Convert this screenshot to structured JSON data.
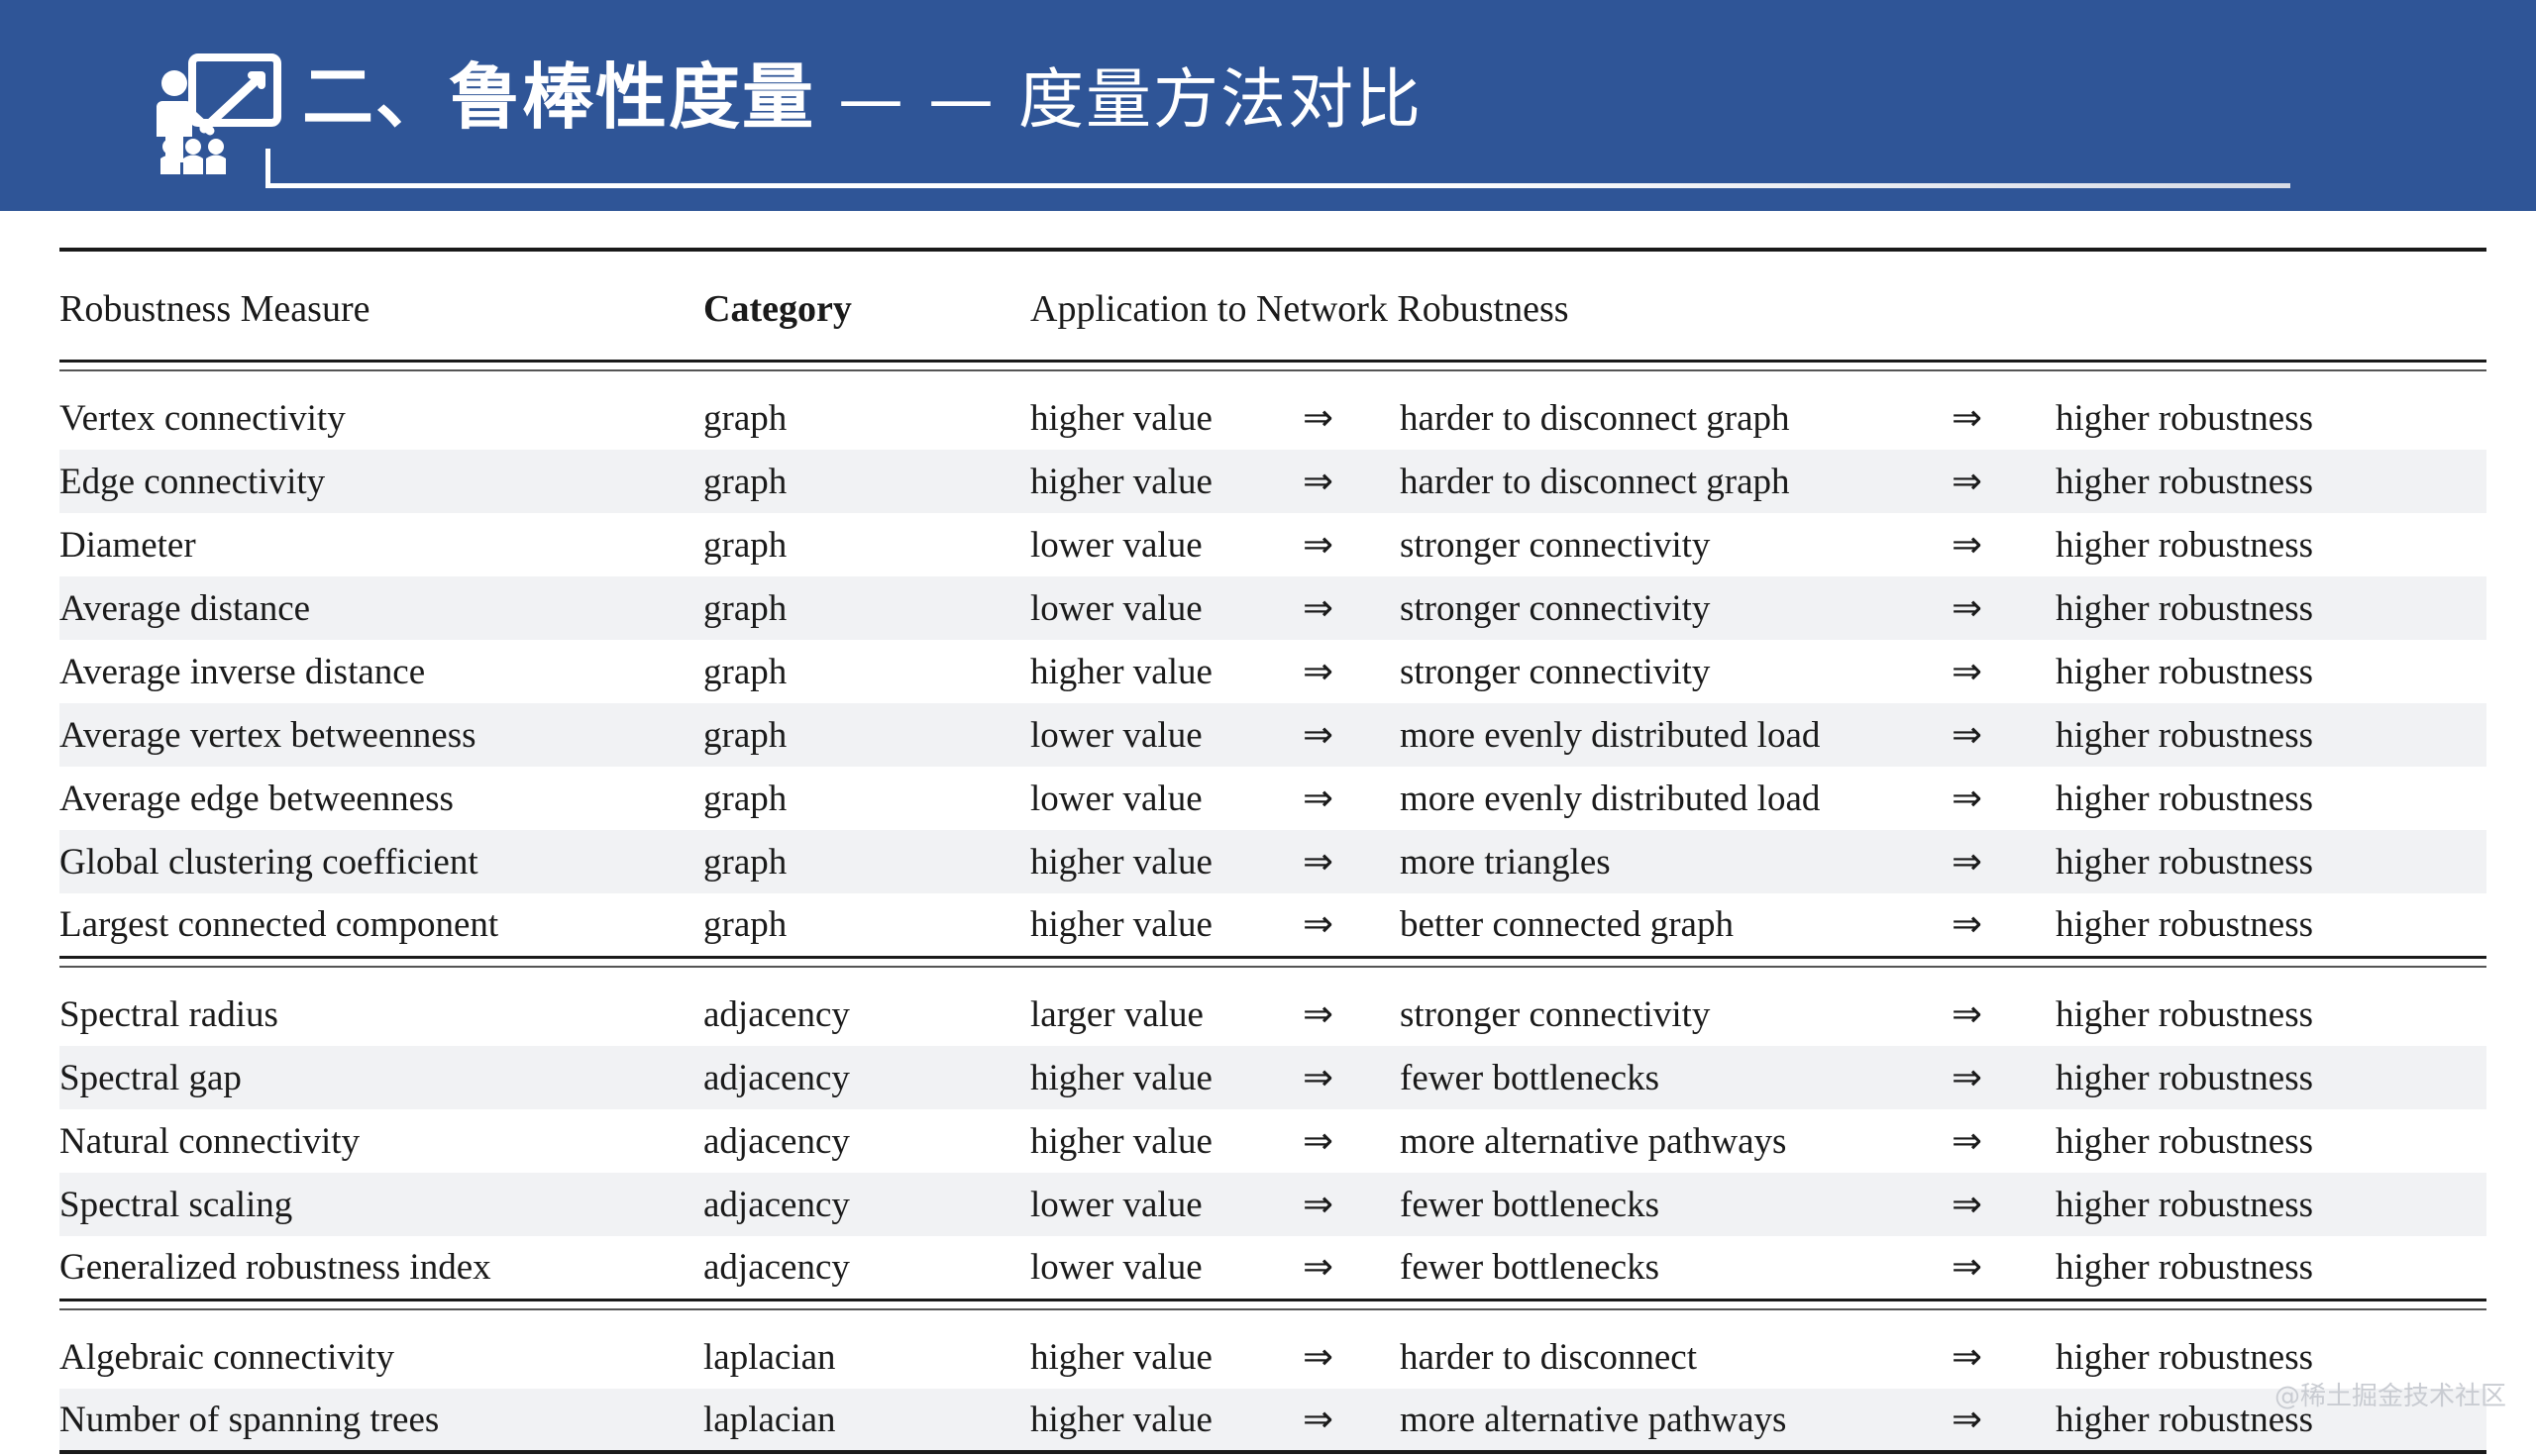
{
  "banner": {
    "background_color": "#2f5597",
    "icon_name": "presenter-whiteboard-icon",
    "title_main": "二、鲁棒性度量",
    "title_sub": " — — 度量方法对比"
  },
  "table": {
    "headers": {
      "measure": "Robustness Measure",
      "category": "Category",
      "application": "Application to Network Robustness"
    },
    "arrow_glyph": "⇒",
    "groups": [
      {
        "name": "graph",
        "rows": [
          {
            "measure": "Vertex connectivity",
            "category": "graph",
            "value": "higher value",
            "a1": "⇒",
            "effect": "harder to disconnect graph",
            "a2": "⇒",
            "result": "higher robustness"
          },
          {
            "measure": "Edge connectivity",
            "category": "graph",
            "value": "higher value",
            "a1": "⇒",
            "effect": "harder to disconnect graph",
            "a2": "⇒",
            "result": "higher robustness"
          },
          {
            "measure": "Diameter",
            "category": "graph",
            "value": "lower value",
            "a1": "⇒",
            "effect": "stronger connectivity",
            "a2": "⇒",
            "result": "higher robustness"
          },
          {
            "measure": "Average distance",
            "category": "graph",
            "value": "lower value",
            "a1": "⇒",
            "effect": "stronger connectivity",
            "a2": "⇒",
            "result": "higher robustness"
          },
          {
            "measure": "Average inverse distance",
            "category": "graph",
            "value": "higher value",
            "a1": "⇒",
            "effect": "stronger connectivity",
            "a2": "⇒",
            "result": "higher robustness"
          },
          {
            "measure": "Average vertex betweenness",
            "category": "graph",
            "value": "lower value",
            "a1": "⇒",
            "effect": "more evenly distributed load",
            "a2": "⇒",
            "result": "higher robustness"
          },
          {
            "measure": "Average edge betweenness",
            "category": "graph",
            "value": "lower value",
            "a1": "⇒",
            "effect": "more evenly distributed load",
            "a2": "⇒",
            "result": "higher robustness"
          },
          {
            "measure": "Global clustering coefficient",
            "category": "graph",
            "value": "higher value",
            "a1": "⇒",
            "effect": "more triangles",
            "a2": "⇒",
            "result": "higher robustness"
          },
          {
            "measure": "Largest connected component",
            "category": "graph",
            "value": "higher value",
            "a1": "⇒",
            "effect": "better connected graph",
            "a2": "⇒",
            "result": "higher robustness"
          }
        ]
      },
      {
        "name": "adjacency",
        "rows": [
          {
            "measure": "Spectral radius",
            "category": "adjacency",
            "value": "larger value",
            "a1": "⇒",
            "effect": "stronger connectivity",
            "a2": "⇒",
            "result": "higher robustness"
          },
          {
            "measure": "Spectral gap",
            "category": "adjacency",
            "value": "higher value",
            "a1": "⇒",
            "effect": "fewer bottlenecks",
            "a2": "⇒",
            "result": "higher robustness"
          },
          {
            "measure": "Natural connectivity",
            "category": "adjacency",
            "value": "higher value",
            "a1": "⇒",
            "effect": "more alternative pathways",
            "a2": "⇒",
            "result": "higher robustness"
          },
          {
            "measure": "Spectral scaling",
            "category": "adjacency",
            "value": "lower value",
            "a1": "⇒",
            "effect": "fewer bottlenecks",
            "a2": "⇒",
            "result": "higher robustness"
          },
          {
            "measure": "Generalized robustness index",
            "category": "adjacency",
            "value": "lower value",
            "a1": "⇒",
            "effect": "fewer bottlenecks",
            "a2": "⇒",
            "result": "higher robustness"
          }
        ]
      },
      {
        "name": "laplacian",
        "rows": [
          {
            "measure": "Algebraic connectivity",
            "category": "laplacian",
            "value": "higher value",
            "a1": "⇒",
            "effect": "harder to disconnect",
            "a2": "⇒",
            "result": "higher robustness"
          },
          {
            "measure": "Number of spanning trees",
            "category": "laplacian",
            "value": "higher value",
            "a1": "⇒",
            "effect": "more alternative pathways",
            "a2": "⇒",
            "result": "higher robustness"
          }
        ]
      }
    ]
  },
  "watermark": {
    "text": "@稀土掘金技术社区"
  }
}
